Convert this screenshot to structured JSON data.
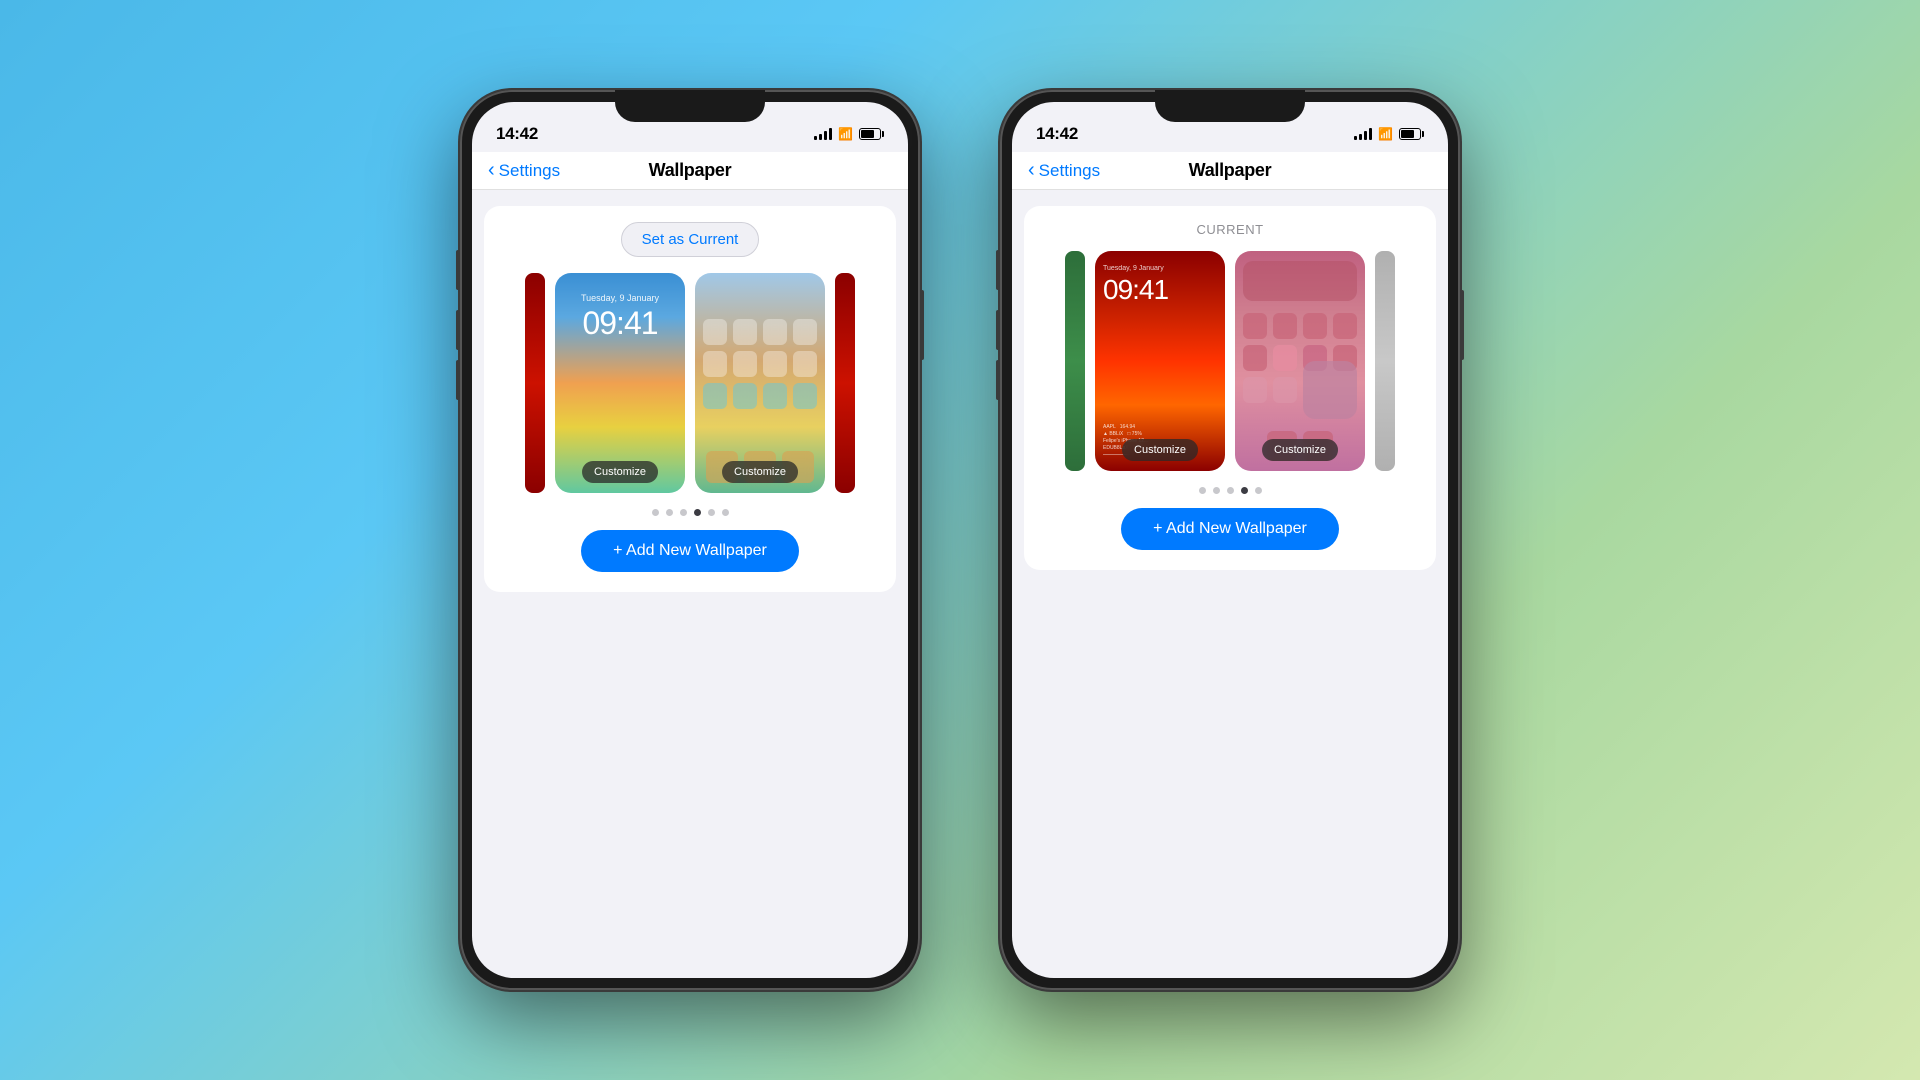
{
  "background": {
    "gradient": "linear-gradient(135deg, #4ab8e8 0%, #5bc8f5 30%, #a8d8a0 70%, #d4e8b0 100%)"
  },
  "phone1": {
    "status": {
      "time": "14:42",
      "battery": "40"
    },
    "nav": {
      "back": "Settings",
      "title": "Wallpaper"
    },
    "set_current_label": "Set as Current",
    "dots": [
      false,
      false,
      false,
      true,
      false,
      false
    ],
    "add_button": "+ Add New Wallpaper",
    "customize_label": "Customize"
  },
  "phone2": {
    "status": {
      "time": "14:42",
      "battery": "40"
    },
    "nav": {
      "back": "Settings",
      "title": "Wallpaper"
    },
    "current_label": "CURRENT",
    "dots": [
      false,
      false,
      false,
      true,
      false
    ],
    "add_button": "+ Add New Wallpaper",
    "customize_label": "Customize"
  }
}
